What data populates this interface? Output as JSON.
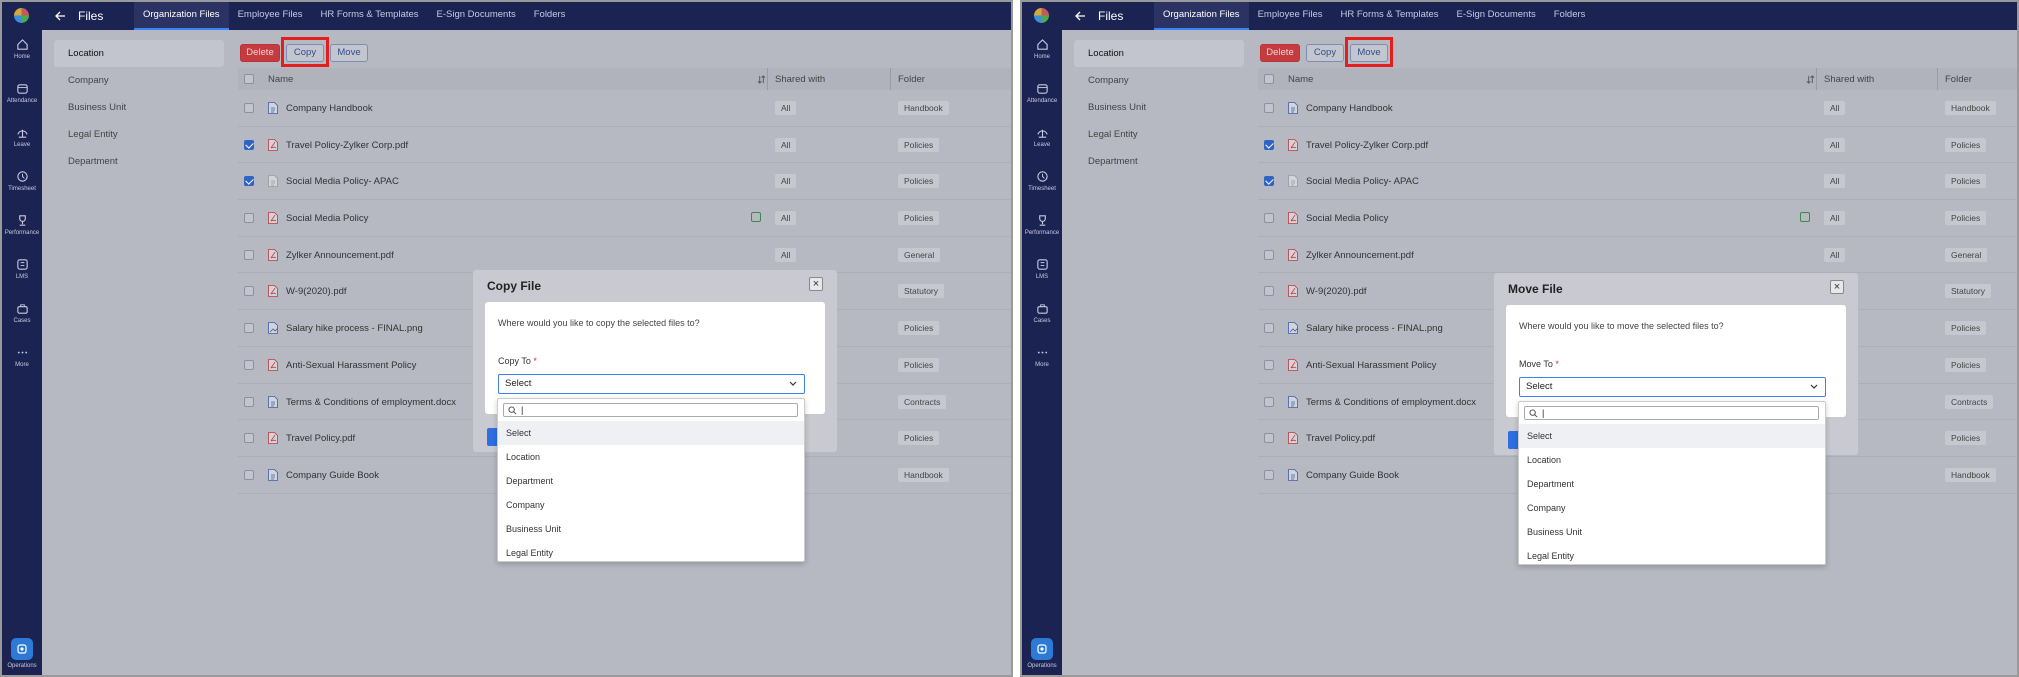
{
  "app": {
    "title": "Files"
  },
  "nav": [
    {
      "label": "Home",
      "icon": "home-icon"
    },
    {
      "label": "Attendance",
      "icon": "attendance-icon"
    },
    {
      "label": "Leave",
      "icon": "leave-icon"
    },
    {
      "label": "Timesheet",
      "icon": "timesheet-icon"
    },
    {
      "label": "Performance",
      "icon": "performance-icon"
    },
    {
      "label": "LMS",
      "icon": "lms-icon"
    },
    {
      "label": "Cases",
      "icon": "cases-icon"
    },
    {
      "label": "More",
      "icon": "more-icon"
    }
  ],
  "operations": {
    "label": "Operations"
  },
  "tabs": [
    {
      "label": "Organization Files",
      "active": true
    },
    {
      "label": "Employee Files"
    },
    {
      "label": "HR Forms & Templates"
    },
    {
      "label": "E-Sign Documents"
    },
    {
      "label": "Folders"
    }
  ],
  "sidebar": [
    "Location",
    "Company",
    "Business Unit",
    "Legal Entity",
    "Department"
  ],
  "toolbar": {
    "delete": "Delete",
    "copy": "Copy",
    "move": "Move"
  },
  "table": {
    "headers": {
      "name": "Name",
      "shared": "Shared with",
      "folder": "Folder"
    },
    "rows": [
      {
        "name": "Company Handbook",
        "type": "doc",
        "checked": false,
        "shared": "All",
        "folder": "Handbook"
      },
      {
        "name": "Travel Policy-Zylker Corp.pdf",
        "type": "pdf",
        "checked": true,
        "shared": "All",
        "folder": "Policies"
      },
      {
        "name": "Social Media Policy- APAC",
        "type": "file",
        "checked": true,
        "shared": "All",
        "folder": "Policies"
      },
      {
        "name": "Social Media Policy",
        "type": "pdf",
        "checked": false,
        "shared": "All",
        "folder": "Policies",
        "sheet": true
      },
      {
        "name": "Zylker Announcement.pdf",
        "type": "pdf",
        "checked": false,
        "shared": "All",
        "folder": "General"
      },
      {
        "name": "W-9(2020).pdf",
        "type": "pdf",
        "checked": false,
        "shared": "",
        "folder": "Statutory"
      },
      {
        "name": "Salary hike process - FINAL.png",
        "type": "img",
        "checked": false,
        "shared": "",
        "folder": "Policies"
      },
      {
        "name": "Anti-Sexual Harassment Policy",
        "type": "pdf",
        "checked": false,
        "shared": "",
        "folder": "Policies"
      },
      {
        "name": "Terms & Conditions of employment.docx",
        "type": "doc",
        "checked": false,
        "shared": "",
        "folder": "Contracts"
      },
      {
        "name": "Travel Policy.pdf",
        "type": "pdf",
        "checked": false,
        "shared": "",
        "folder": "Policies"
      },
      {
        "name": "Company Guide Book",
        "type": "book",
        "checked": false,
        "shared": "",
        "folder": "Handbook"
      }
    ]
  },
  "dialogs": {
    "copy": {
      "title": "Copy File",
      "question": "Where would you like to copy the selected files to?",
      "label": "Copy To",
      "value": "Select"
    },
    "move": {
      "title": "Move File",
      "question": "Where would you like to move the selected files to?",
      "label": "Move To",
      "value": "Select"
    }
  },
  "dropdown": {
    "search_value": "|",
    "options": [
      "Select",
      "Location",
      "Department",
      "Company",
      "Business Unit",
      "Legal Entity"
    ]
  },
  "colors": {
    "rail": "#1b2352",
    "delete": "#c43c3f",
    "accent": "#3b82f6",
    "highlight": "#e41d1d"
  }
}
